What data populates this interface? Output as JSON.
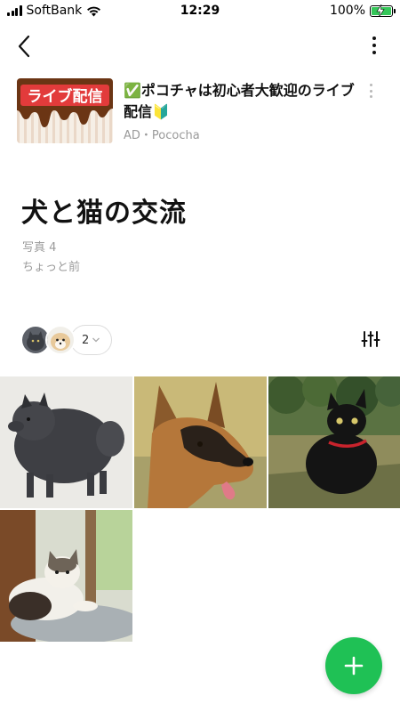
{
  "status_bar": {
    "carrier": "SoftBank",
    "time": "12:29",
    "battery": "100%",
    "battery_level": 1.0
  },
  "header": {
    "back_icon": "chevron-left-icon",
    "more_icon": "more-vertical-icon"
  },
  "ad": {
    "thumbnail_text": "ライブ配信",
    "title": "✅ポコチャは初心者大歓迎のライブ配信🔰",
    "sponsor": "AD・Pococha"
  },
  "album": {
    "title": "犬と猫の交流",
    "photo_count": "写真 4",
    "updated": "ちょっと前"
  },
  "members": {
    "count": "2",
    "filter_icon": "sliders-icon"
  },
  "photos": [
    {
      "subject": "pomeranian"
    },
    {
      "subject": "german-shepherd"
    },
    {
      "subject": "black-cat"
    },
    {
      "subject": "cat-on-table"
    }
  ],
  "fab": {
    "icon": "plus-icon"
  },
  "colors": {
    "accent": "#1fc155",
    "text_primary": "#111111",
    "text_secondary": "#9b9b9b",
    "battery_green": "#35c759"
  }
}
